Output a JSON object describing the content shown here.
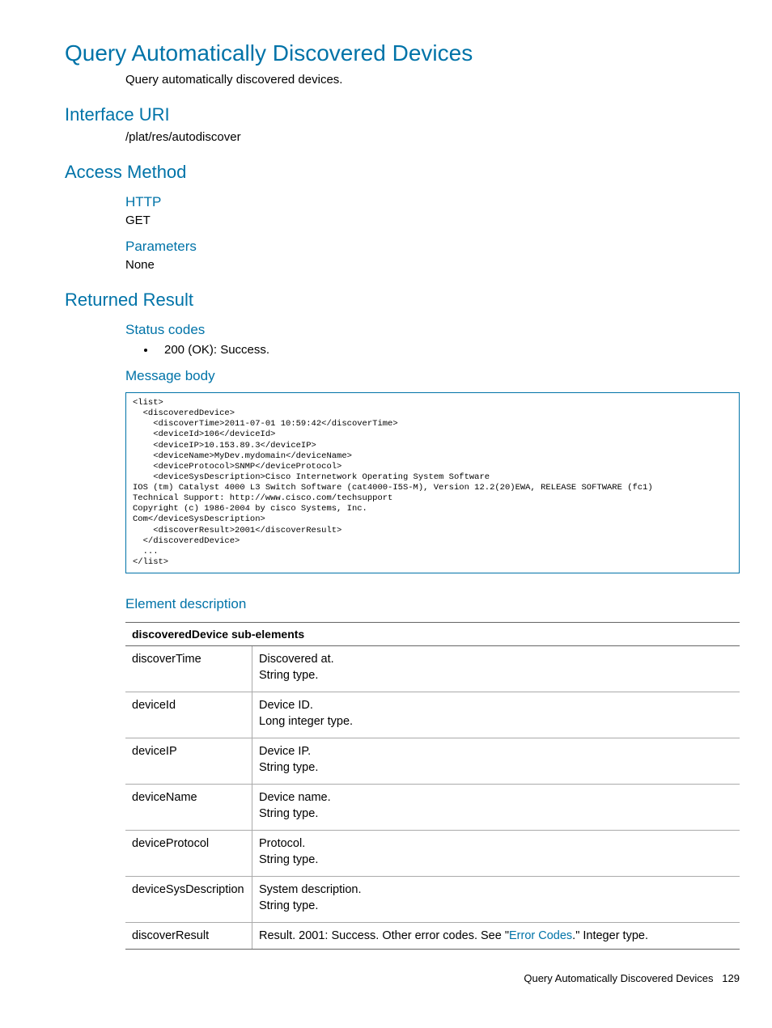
{
  "title": "Query Automatically Discovered Devices",
  "intro": "Query automatically discovered devices.",
  "sections": {
    "interface_uri": {
      "heading": "Interface URI",
      "value": "/plat/res/autodiscover"
    },
    "access_method": {
      "heading": "Access Method",
      "http_heading": "HTTP",
      "http_value": "GET",
      "params_heading": "Parameters",
      "params_value": "None"
    },
    "returned_result": {
      "heading": "Returned Result",
      "status_heading": "Status codes",
      "status_item": "200 (OK): Success.",
      "msgbody_heading": "Message body",
      "code": "<list>\n  <discoveredDevice>\n    <discoverTime>2011-07-01 10:59:42</discoverTime>\n    <deviceId>106</deviceId>\n    <deviceIP>10.153.89.3</deviceIP>\n    <deviceName>MyDev.mydomain</deviceName>\n    <deviceProtocol>SNMP</deviceProtocol>\n    <deviceSysDescription>Cisco Internetwork Operating System Software\nIOS (tm) Catalyst 4000 L3 Switch Software (cat4000-I5S-M), Version 12.2(20)EWA, RELEASE SOFTWARE (fc1)\nTechnical Support: http://www.cisco.com/techsupport\nCopyright (c) 1986-2004 by cisco Systems, Inc.\nCom</deviceSysDescription>\n    <discoverResult>2001</discoverResult>\n  </discoveredDevice>\n  ...\n</list>",
      "elem_heading": "Element description"
    }
  },
  "table": {
    "header": "discoveredDevice sub-elements",
    "rows": [
      {
        "name": "discoverTime",
        "l1": "Discovered at.",
        "l2": "String type."
      },
      {
        "name": "deviceId",
        "l1": "Device ID.",
        "l2": "Long integer type."
      },
      {
        "name": "deviceIP",
        "l1": "Device IP.",
        "l2": "String type."
      },
      {
        "name": "deviceName",
        "l1": "Device name.",
        "l2": "String type."
      },
      {
        "name": "deviceProtocol",
        "l1": "Protocol.",
        "l2": "String type."
      },
      {
        "name": "deviceSysDescription",
        "l1": "System description.",
        "l2": "String type."
      },
      {
        "name": "discoverResult",
        "pre": "Result. 2001: Success. Other error codes. See \"",
        "link": "Error Codes",
        "post": ".\" Integer type."
      }
    ]
  },
  "footer": {
    "title": "Query Automatically Discovered Devices",
    "page": "129"
  }
}
